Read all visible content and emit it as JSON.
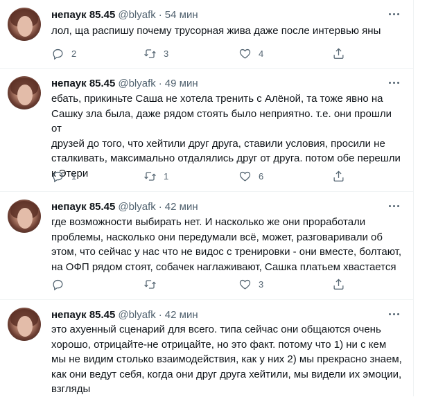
{
  "tweets": [
    {
      "name": "непаук 85.45",
      "handle": "@blyafk",
      "separator": "·",
      "time": "54 мин",
      "text": "лол, ща распишу почему трусорная жива даже после интервью яны",
      "replies": "2",
      "retweets": "3",
      "likes": "4"
    },
    {
      "name": "непаук 85.45",
      "handle": "@blyafk",
      "separator": "·",
      "time": "49 мин",
      "text": "ебать, прикиньте Саша не хотела тренить с Алёной, та тоже явно на\nСашку зла была, даже рядом стоять было неприятно. т.е. они прошли от\nдрузей до того, что хейтили друг друга, ставили условия, просили не\nсталкивать, максимально отдалялись друг от друга. потом обе перешли\nк Этери",
      "replies": "1",
      "retweets": "1",
      "likes": "6"
    },
    {
      "name": "непаук 85.45",
      "handle": "@blyafk",
      "separator": "·",
      "time": "42 мин",
      "text": "где возможности выбирать нет. И насколько же они проработали\nпроблемы, насколько они передумали всё, может, разговаривали об\nэтом, что сейчас у нас что не видос с тренировки - они вместе, болтают,\nна ОФП рядом стоят, собачек наглаживают, Сашка платьем хвастается",
      "replies": "",
      "retweets": "",
      "likes": "3"
    },
    {
      "name": "непаук 85.45",
      "handle": "@blyafk",
      "separator": "·",
      "time": "42 мин",
      "text": "это ахуенный сценарий для всего. типа сейчас они общаются очень\nхорошо, отрицайте-не отрицайте, но это факт. потому что 1) ни с кем\nмы не видим столько взаимодействия, как у них 2) мы прекрасно знаем,\nкак они ведут себя, когда они друг друга хейтили, мы видели их эмоции,\nвзгляды"
    }
  ],
  "icons": {
    "reply": "reply-icon",
    "retweet": "retweet-icon",
    "like": "heart-icon",
    "share": "share-icon",
    "more": "more-icon"
  }
}
